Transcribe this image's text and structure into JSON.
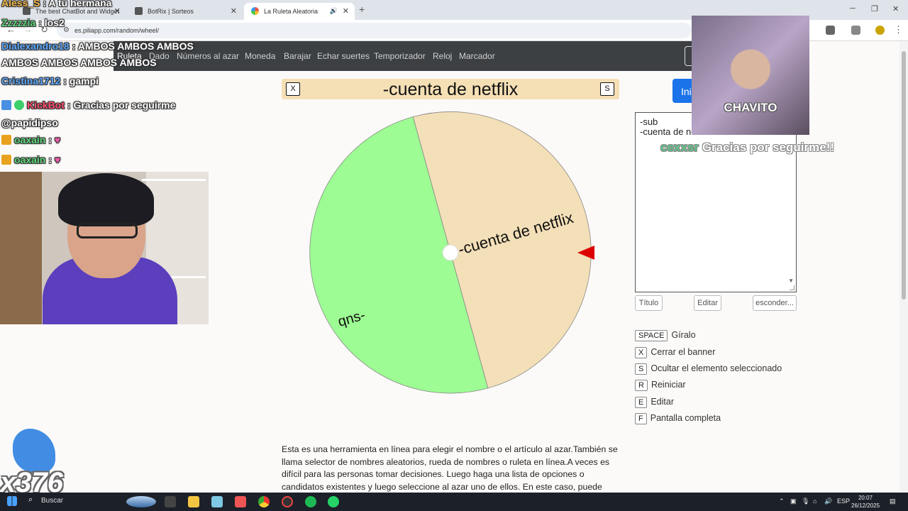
{
  "browser": {
    "tabs": [
      {
        "label": "The best ChatBot and Widget"
      },
      {
        "label": "BotRix | Sorteos"
      },
      {
        "label": "La Ruleta Aleatoria"
      }
    ],
    "url": "es.piliapp.com/random/wheel/"
  },
  "site_nav": [
    "Ruleta",
    "Dado",
    "Números al azar",
    "Moneda",
    "Barajar",
    "Echar suertes",
    "Temporizador",
    "Reloj",
    "Marcador"
  ],
  "banner": {
    "close_key": "X",
    "title": "-cuenta de netflix",
    "hide_key": "S"
  },
  "wheel": {
    "segments": [
      {
        "label": "-cuenta de netflix",
        "color": "#f3dfb8"
      },
      {
        "label": "qns-",
        "color": "#9dfc93"
      }
    ],
    "pointer_color": "#dd0000"
  },
  "start_button": {
    "label": "Ini"
  },
  "entries": {
    "lines": [
      "-sub",
      "-cuenta de netflix"
    ]
  },
  "panel_buttons": {
    "title": "Título",
    "edit": "Editar",
    "hide": "esconder..."
  },
  "shortcuts": [
    {
      "key": "SPACE",
      "label": "Gíralo"
    },
    {
      "key": "X",
      "label": "Cerrar el banner"
    },
    {
      "key": "S",
      "label": "Ocultar el elemento seleccionado"
    },
    {
      "key": "R",
      "label": "Reiniciar"
    },
    {
      "key": "E",
      "label": "Editar"
    },
    {
      "key": "F",
      "label": "Pantalla completa"
    }
  ],
  "description": "Esta es una herramienta en línea para elegir el nombre o el artículo al azar.También se llama selector de nombres aleatorios, rueda de nombres o ruleta en línea.A veces es difícil para las personas tomar decisiones. Luego haga una lista de opciones o candidatos existentes y luego seleccione al azar uno de ellos. En este caso, puede utilizar nuestra herramienta para",
  "stream_overlay": {
    "chat": [
      {
        "user": "Aless_S",
        "user_color": "#f2b84b",
        "message": ": A tu hermana"
      },
      {
        "user": "Zzzzzia",
        "user_color": "#5ed67a",
        "message": ": los2"
      },
      {
        "user": "Dialexandro18",
        "user_color": "#5aa7ff",
        "message": ": AMBOS AMBOS AMBOS AMBOS AMBOS AMBOS AMBOS"
      },
      {
        "user": "Cristina1712",
        "user_color": "#5aa7ff",
        "message": ": gampi"
      },
      {
        "user": "KickBot",
        "user_color": "#ff4d6d",
        "message": ": Gracias por seguirme @papidipso"
      },
      {
        "user": "oaxain",
        "user_color": "#5ed67a",
        "message": ":"
      },
      {
        "user": "oaxain",
        "user_color": "#5ed67a",
        "message": ":"
      }
    ],
    "gift_name": "CHAVITO",
    "follow_alert": {
      "user": "cexxsr",
      "message": "Gracias por seguirme!!"
    },
    "combo_count": "x376"
  },
  "taskbar": {
    "search": "Buscar",
    "lang": "ESP",
    "time": "20:07",
    "date": "26/12/2025"
  }
}
